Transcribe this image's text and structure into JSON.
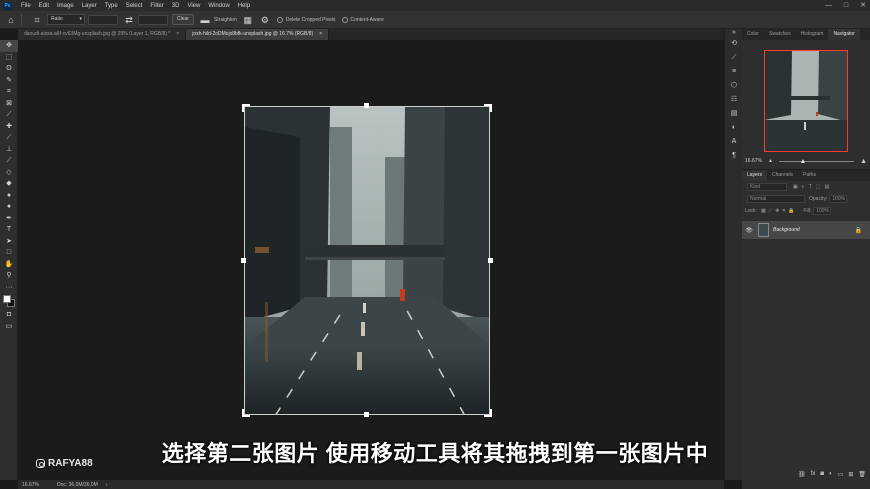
{
  "app": {
    "logo_text": "Ps"
  },
  "menu": [
    "File",
    "Edit",
    "Image",
    "Layer",
    "Type",
    "Select",
    "Filter",
    "3D",
    "View",
    "Window",
    "Help"
  ],
  "window_controls": [
    "—",
    "□",
    "✕"
  ],
  "options": {
    "ratio_label": "Ratio",
    "clear_label": "Clear",
    "straighten_label": "Straighten",
    "delete_cropped_label": "Delete Cropped Pixels",
    "content_aware_label": "Content-Aware"
  },
  "tabs": [
    {
      "label": "daoudi-aissa-a6f-cv63Mg-unsplash.jpg @ 29% (Layer 1, RGB/8) *",
      "close": "×"
    },
    {
      "label": "josh-hild-2oDMojx8bfk-unsplash.jpg @ 16.7% (RGB/8)",
      "close": "×"
    }
  ],
  "status": {
    "zoom": "16.67%",
    "doc": "Doc: 36,0M/36,0M"
  },
  "watermark": {
    "handle": "RAFYA88"
  },
  "subtitle": "选择第二张图片 使用移动工具将其拖拽到第一张图片中",
  "panel_tabs_top": [
    "Color",
    "Swatches",
    "Histogram",
    "Navigator"
  ],
  "navigator": {
    "zoom_value": "16.67%",
    "zoom_level": 0.33
  },
  "panel_tabs_layers": [
    "Layers",
    "Channels",
    "Paths"
  ],
  "layers": {
    "filter_placeholder": "Kind",
    "blend_mode": "Normal",
    "opacity_label": "Opacity:",
    "opacity_value": "100%",
    "lock_label": "Lock:",
    "fill_label": "Fill:",
    "fill_value": "100%",
    "items": [
      {
        "name": "Background",
        "visible": true,
        "locked": true
      }
    ]
  },
  "icons": {
    "tools": [
      "move-tool-icon",
      "marquee-icon",
      "lasso-icon",
      "quick-select-icon",
      "crop-icon",
      "frame-icon",
      "eyedropper-icon",
      "healing-brush-icon",
      "brush-icon",
      "clone-stamp-icon",
      "history-brush-icon",
      "eraser-icon",
      "gradient-icon",
      "blur-icon",
      "dodge-icon",
      "pen-icon",
      "type-icon",
      "path-select-icon",
      "rectangle-icon",
      "hand-icon",
      "zoom-icon",
      "more-tools-icon"
    ]
  }
}
